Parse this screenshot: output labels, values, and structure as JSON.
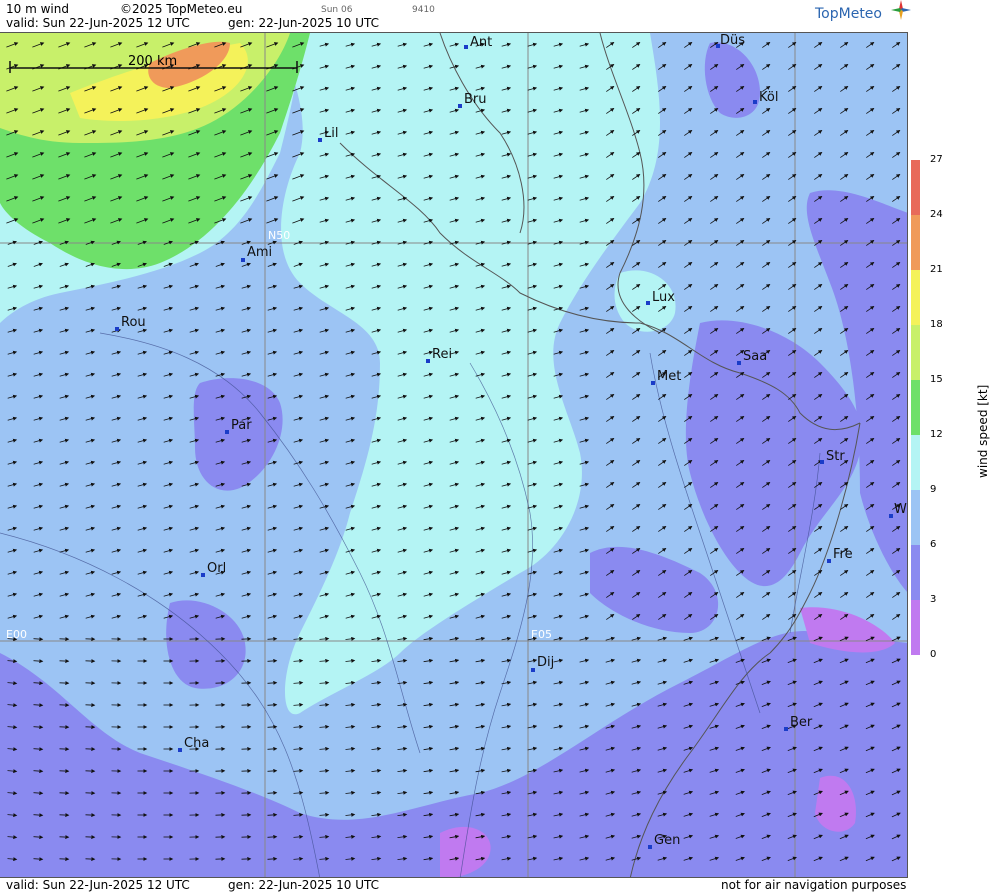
{
  "header": {
    "product": "10 m wind",
    "copyright": "©2025 TopMeteo.eu",
    "small_day": "Sun 06",
    "small_code": "9410",
    "valid": "valid:  Sun  22-Jun-2025  12 UTC",
    "gen": "gen: 22-Jun-2025 10 UTC",
    "logo": "TopMeteo"
  },
  "footer": {
    "valid": "valid:  Sun  22-Jun-2025  12 UTC",
    "gen": "gen: 22-Jun-2025 10 UTC",
    "disclaimer": "not for air navigation purposes"
  },
  "map": {
    "scale_label": "200 km",
    "grid_labels": [
      "N50",
      "E00",
      "E05"
    ],
    "cities": [
      {
        "name": "Ant"
      },
      {
        "name": "Düs"
      },
      {
        "name": "Bru"
      },
      {
        "name": "Köl"
      },
      {
        "name": "Lil"
      },
      {
        "name": "Ami"
      },
      {
        "name": "Lux"
      },
      {
        "name": "Rou"
      },
      {
        "name": "Rei"
      },
      {
        "name": "Saa"
      },
      {
        "name": "Met"
      },
      {
        "name": "Par"
      },
      {
        "name": "Str"
      },
      {
        "name": "W"
      },
      {
        "name": "Fre"
      },
      {
        "name": "Orl"
      },
      {
        "name": "Dij"
      },
      {
        "name": "Ber"
      },
      {
        "name": "Cha"
      },
      {
        "name": "Gen"
      }
    ]
  },
  "legend": {
    "title": "wind speed [kt]",
    "ticks": [
      "27",
      "24",
      "21",
      "18",
      "15",
      "12",
      "9",
      "6",
      "3",
      "0"
    ],
    "colors": [
      "#e86a5a",
      "#f09a5a",
      "#f4d25a",
      "#f4f25a",
      "#c8f06a",
      "#6ee06a",
      "#b4f4f4",
      "#9cc4f4",
      "#8a8af0",
      "#c07af0"
    ]
  }
}
